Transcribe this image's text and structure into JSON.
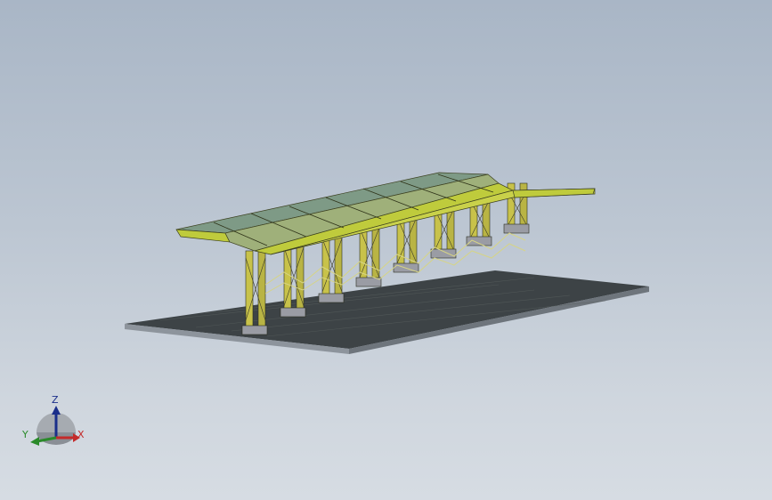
{
  "viewport": {
    "background_top": "#a9b6c6",
    "background_bottom": "#d6dce3"
  },
  "model": {
    "base_plate_color": "#3d4346",
    "roof_color": "#bfcb3c",
    "roof_panel_color": "#7e9a86",
    "column_color": "#c8c24a",
    "footing_color": "#9a9ca4"
  },
  "triad": {
    "x_label": "X",
    "y_label": "Y",
    "z_label": "Z",
    "x_color": "#c42a2a",
    "y_color": "#2a8a2a",
    "z_color": "#1b2f8a"
  }
}
